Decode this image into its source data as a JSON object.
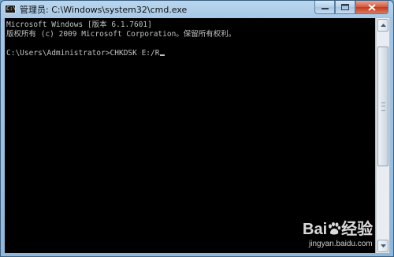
{
  "window": {
    "title": "管理员: C:\\Windows\\system32\\cmd.exe",
    "icon": "cmd-icon",
    "controls": {
      "minimize": "minimize-icon",
      "maximize": "maximize-icon",
      "close": "close-icon"
    }
  },
  "console": {
    "lines": [
      "Microsoft Windows [版本 6.1.7601]",
      "版权所有 (c) 2009 Microsoft Corporation。保留所有权利。",
      "",
      "C:\\Users\\Administrator>CHKDSK E:/R"
    ],
    "text_color": "#c0c0c0",
    "background": "#000000"
  },
  "watermark": {
    "logo_text_1": "Bai",
    "logo_text_2": "经验",
    "url": "jingyan.baidu.com"
  }
}
